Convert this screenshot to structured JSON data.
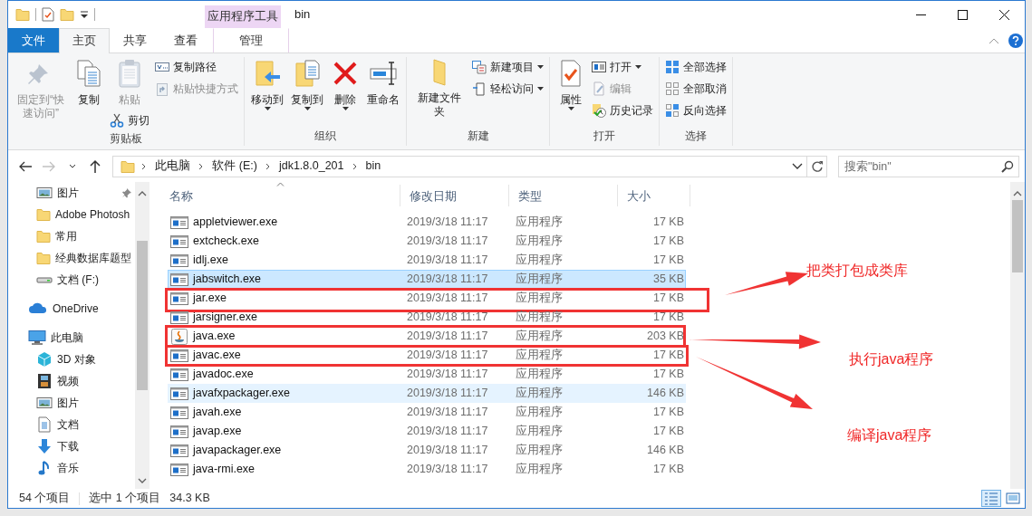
{
  "window": {
    "title": "bin",
    "context_tab": "应用程序工具"
  },
  "ribbon_tabs": [
    {
      "label": "文件",
      "kind": "file",
      "selected": false
    },
    {
      "label": "主页",
      "kind": "tab",
      "selected": true
    },
    {
      "label": "共享",
      "kind": "tab",
      "selected": false
    },
    {
      "label": "查看",
      "kind": "tab",
      "selected": false
    },
    {
      "label": "管理",
      "kind": "context",
      "selected": false
    }
  ],
  "ribbon_groups": [
    {
      "label": "剪贴板",
      "columns": [
        [
          {
            "label": "固定到“快速访问”",
            "kind": "large",
            "disabled": true,
            "dropdown": false
          }
        ],
        [
          {
            "label": "复制",
            "kind": "large",
            "disabled": false,
            "dropdown": false
          }
        ],
        [
          {
            "label": "粘贴",
            "kind": "large",
            "disabled": true,
            "dropdown": false
          },
          {
            "label": "剪切",
            "kind": "small",
            "disabled": false,
            "dropdown": false
          }
        ],
        [
          {
            "label": "复制路径",
            "kind": "small",
            "disabled": false,
            "dropdown": false
          },
          {
            "label": "粘贴快捷方式",
            "kind": "small",
            "disabled": true,
            "dropdown": false
          }
        ]
      ]
    },
    {
      "label": "组织",
      "columns": [
        [
          {
            "label": "移动到",
            "kind": "large",
            "disabled": false,
            "dropdown": true
          }
        ],
        [
          {
            "label": "复制到",
            "kind": "large",
            "disabled": false,
            "dropdown": true
          }
        ],
        [
          {
            "label": "删除",
            "kind": "large",
            "disabled": false,
            "dropdown": true
          }
        ],
        [
          {
            "label": "重命名",
            "kind": "large",
            "disabled": false,
            "dropdown": false
          }
        ]
      ]
    },
    {
      "label": "新建",
      "columns": [
        [
          {
            "label": "新建文件夹",
            "kind": "large",
            "disabled": false,
            "dropdown": false
          }
        ],
        [
          {
            "label": "新建项目",
            "kind": "small",
            "disabled": false,
            "dropdown": true
          },
          {
            "label": "轻松访问",
            "kind": "small",
            "disabled": false,
            "dropdown": true
          }
        ]
      ]
    },
    {
      "label": "打开",
      "columns": [
        [
          {
            "label": "属性",
            "kind": "large",
            "disabled": false,
            "dropdown": true
          }
        ],
        [
          {
            "label": "打开",
            "kind": "small",
            "disabled": false,
            "dropdown": true
          },
          {
            "label": "编辑",
            "kind": "small",
            "disabled": true,
            "dropdown": false
          },
          {
            "label": "历史记录",
            "kind": "small",
            "disabled": false,
            "dropdown": false
          }
        ]
      ]
    },
    {
      "label": "选择",
      "columns": [
        [
          {
            "label": "全部选择",
            "kind": "small",
            "disabled": false,
            "dropdown": false
          },
          {
            "label": "全部取消",
            "kind": "small",
            "disabled": false,
            "dropdown": false
          },
          {
            "label": "反向选择",
            "kind": "small",
            "disabled": false,
            "dropdown": false
          }
        ]
      ]
    }
  ],
  "address_bar": {
    "nav_buttons": [
      {
        "kind": "back",
        "disabled": false
      },
      {
        "kind": "forward",
        "disabled": true
      },
      {
        "kind": "recent",
        "disabled": false
      },
      {
        "kind": "up",
        "disabled": false
      }
    ],
    "breadcrumbs": [
      "此电脑",
      "软件 (E:)",
      "jdk1.8.0_201",
      "bin"
    ],
    "search": {
      "placeholder": "搜索\"bin\""
    }
  },
  "navigation_pane": {
    "quick_access": [
      {
        "label": "图片",
        "kind": "pictures",
        "pinned": true
      },
      {
        "label": "Adobe Photosh",
        "kind": "folder",
        "pinned": false
      },
      {
        "label": "常用",
        "kind": "folder",
        "pinned": false
      },
      {
        "label": "经典数据库题型",
        "kind": "folder",
        "pinned": false
      },
      {
        "label": "文档 (F:)",
        "kind": "drive",
        "pinned": false
      }
    ],
    "tree": [
      {
        "label": "OneDrive",
        "kind": "cloud"
      },
      {
        "label": "此电脑",
        "kind": "pc",
        "children": [
          {
            "label": "3D 对象",
            "kind": "objects3d"
          },
          {
            "label": "视频",
            "kind": "videos"
          },
          {
            "label": "图片",
            "kind": "pictures"
          },
          {
            "label": "文档",
            "kind": "documents"
          },
          {
            "label": "下载",
            "kind": "downloads"
          },
          {
            "label": "音乐",
            "kind": "music"
          }
        ]
      }
    ]
  },
  "file_list": {
    "columns": [
      {
        "label": "名称",
        "sorted": true
      },
      {
        "label": "修改日期",
        "sorted": false
      },
      {
        "label": "类型",
        "sorted": false
      },
      {
        "label": "大小",
        "sorted": false
      }
    ],
    "rows": [
      {
        "name": "appletviewer.exe",
        "date": "2019/3/18 11:17",
        "type": "应用程序",
        "size": "17 KB",
        "kind": "app",
        "selected": false,
        "hovered": false,
        "boxed": false
      },
      {
        "name": "extcheck.exe",
        "date": "2019/3/18 11:17",
        "type": "应用程序",
        "size": "17 KB",
        "kind": "app",
        "selected": false,
        "hovered": false,
        "boxed": false
      },
      {
        "name": "idlj.exe",
        "date": "2019/3/18 11:17",
        "type": "应用程序",
        "size": "17 KB",
        "kind": "app",
        "selected": false,
        "hovered": false,
        "boxed": false
      },
      {
        "name": "jabswitch.exe",
        "date": "2019/3/18 11:17",
        "type": "应用程序",
        "size": "35 KB",
        "kind": "app",
        "selected": true,
        "hovered": false,
        "boxed": false
      },
      {
        "name": "jar.exe",
        "date": "2019/3/18 11:17",
        "type": "应用程序",
        "size": "17 KB",
        "kind": "app",
        "selected": false,
        "hovered": false,
        "boxed": true
      },
      {
        "name": "jarsigner.exe",
        "date": "2019/3/18 11:17",
        "type": "应用程序",
        "size": "17 KB",
        "kind": "app",
        "selected": false,
        "hovered": false,
        "boxed": false
      },
      {
        "name": "java.exe",
        "date": "2019/3/18 11:17",
        "type": "应用程序",
        "size": "203 KB",
        "kind": "java",
        "selected": false,
        "hovered": false,
        "boxed": true
      },
      {
        "name": "javac.exe",
        "date": "2019/3/18 11:17",
        "type": "应用程序",
        "size": "17 KB",
        "kind": "app",
        "selected": false,
        "hovered": false,
        "boxed": true
      },
      {
        "name": "javadoc.exe",
        "date": "2019/3/18 11:17",
        "type": "应用程序",
        "size": "17 KB",
        "kind": "app",
        "selected": false,
        "hovered": false,
        "boxed": false
      },
      {
        "name": "javafxpackager.exe",
        "date": "2019/3/18 11:17",
        "type": "应用程序",
        "size": "146 KB",
        "kind": "app",
        "selected": false,
        "hovered": true,
        "boxed": false
      },
      {
        "name": "javah.exe",
        "date": "2019/3/18 11:17",
        "type": "应用程序",
        "size": "17 KB",
        "kind": "app",
        "selected": false,
        "hovered": false,
        "boxed": false
      },
      {
        "name": "javap.exe",
        "date": "2019/3/18 11:17",
        "type": "应用程序",
        "size": "17 KB",
        "kind": "app",
        "selected": false,
        "hovered": false,
        "boxed": false
      },
      {
        "name": "javapackager.exe",
        "date": "2019/3/18 11:17",
        "type": "应用程序",
        "size": "146 KB",
        "kind": "app",
        "selected": false,
        "hovered": false,
        "boxed": false
      },
      {
        "name": "java-rmi.exe",
        "date": "2019/3/18 11:17",
        "type": "应用程序",
        "size": "17 KB",
        "kind": "app",
        "selected": false,
        "hovered": false,
        "boxed": false
      }
    ]
  },
  "status_bar": {
    "item_count": "54 个项目",
    "selection": "选中 1 个项目",
    "selection_size": "34.3 KB",
    "view_buttons": [
      {
        "kind": "details",
        "selected": true
      },
      {
        "kind": "large_icons",
        "selected": false
      }
    ]
  },
  "annotations": [
    {
      "text": "把类打包成类库"
    },
    {
      "text": "执行java程序"
    },
    {
      "text": "编译java程序"
    }
  ]
}
